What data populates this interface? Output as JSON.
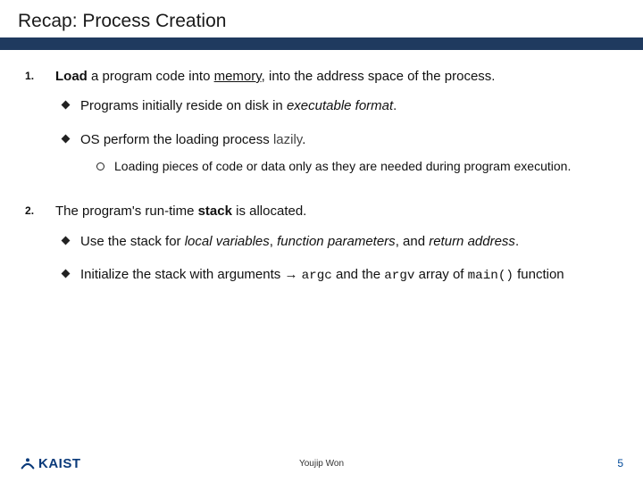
{
  "slide": {
    "title": "Recap: Process Creation"
  },
  "item1": {
    "lead_1": "Load",
    "lead_2": " a program code into ",
    "lead_3": "memory",
    "lead_4": ", into the address space of the process.",
    "sub_a_1": "Programs initially reside on disk in ",
    "sub_a_2": "executable format",
    "sub_a_3": ".",
    "sub_b_1": "OS perform the loading process ",
    "sub_b_2": "lazily",
    "sub_b_3": ".",
    "sub_b_c_1": "Loading pieces of code or data only as they are needed during program execution."
  },
  "item2": {
    "lead_1": "The program's run-time ",
    "lead_2": "stack",
    "lead_3": " is allocated.",
    "sub_a_1": "Use the stack for ",
    "sub_a_2": "local variables",
    "sub_a_3": ", ",
    "sub_a_4": "function parameters",
    "sub_a_5": ", and ",
    "sub_a_6": "return address",
    "sub_a_7": ".",
    "sub_b_1": "Initialize the stack with arguments ",
    "sub_b_arrow": "→",
    "sub_b_2": " ",
    "sub_b_code1": "argc",
    "sub_b_3": " and the ",
    "sub_b_code2": "argv",
    "sub_b_4": " array of ",
    "sub_b_code3": "main()",
    "sub_b_5": " function"
  },
  "footer": {
    "logo_text": "KAIST",
    "author": "Youjip Won",
    "page": "5"
  }
}
